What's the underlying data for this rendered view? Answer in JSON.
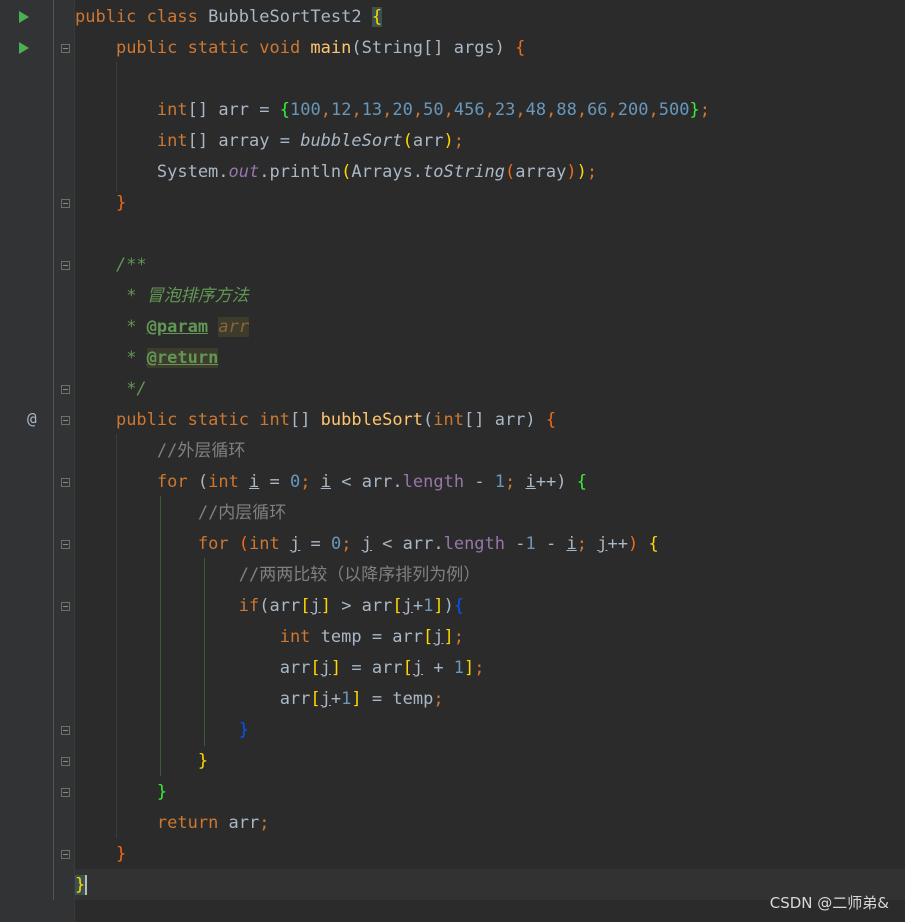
{
  "editor": {
    "lines": [
      "public class BubbleSortTest2 {",
      "    public static void main(String[] args) {",
      "",
      "        int[] arr = {100,12,13,20,50,456,23,48,88,66,200,500};",
      "        int[] array = bubbleSort(arr);",
      "        System.out.println(Arrays.toString(array));",
      "    }",
      "",
      "    /**",
      "     * 冒泡排序方法",
      "     * @param arr",
      "     * @return",
      "     */",
      "    public static int[] bubbleSort(int[] arr) {",
      "        //外层循环",
      "        for (int i = 0; i < arr.length - 1; i++) {",
      "            //内层循环",
      "            for (int j = 0; j < arr.length -1 - i; j++) {",
      "                //两两比较（以降序排列为例）",
      "                if(arr[j] > arr[j+1]){",
      "                    int temp = arr[j];",
      "                    arr[j] = arr[j + 1];",
      "                    arr[j+1] = temp;",
      "                }",
      "            }",
      "        }",
      "        return arr;",
      "    }",
      "}"
    ]
  },
  "gutter": {
    "override_marker": "@"
  },
  "watermark": "CSDN @二师弟&",
  "colors": {
    "keyword": "#cc7832",
    "number": "#6897bb",
    "field": "#9876aa",
    "method": "#ffc66d",
    "comment": "#808080",
    "doc": "#629755",
    "background": "#2b2b2b"
  },
  "icons": [
    "run-icon",
    "fold-icon"
  ]
}
